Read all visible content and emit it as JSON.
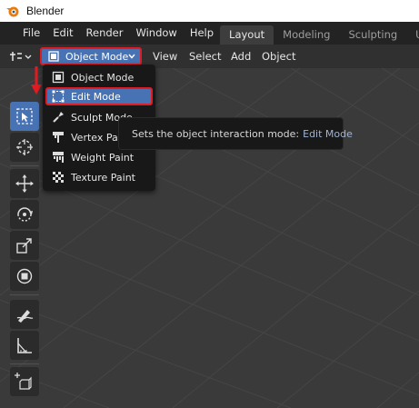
{
  "window": {
    "title": "Blender"
  },
  "menubar": {
    "items": [
      "File",
      "Edit",
      "Render",
      "Window",
      "Help"
    ],
    "workspace_tabs": [
      {
        "label": "Layout",
        "active": true
      },
      {
        "label": "Modeling",
        "active": false
      },
      {
        "label": "Sculpting",
        "active": false
      },
      {
        "label": "UV",
        "active": false
      }
    ]
  },
  "viewport_header": {
    "mode_selected": "Object Mode",
    "menus": [
      "View",
      "Select",
      "Add",
      "Object"
    ]
  },
  "mode_menu": {
    "items": [
      {
        "label": "Object Mode",
        "icon": "object-mode-icon"
      },
      {
        "label": "Edit Mode",
        "icon": "edit-mode-icon",
        "highlighted": true
      },
      {
        "label": "Sculpt Mode",
        "icon": "sculpt-mode-icon"
      },
      {
        "label": "Vertex Paint",
        "icon": "vertex-paint-icon"
      },
      {
        "label": "Weight Paint",
        "icon": "weight-paint-icon"
      },
      {
        "label": "Texture Paint",
        "icon": "texture-paint-icon"
      }
    ]
  },
  "tooltip": {
    "text": "Sets the object interaction mode:",
    "mode": "Edit Mode"
  },
  "toolbar": {
    "tools": [
      "select-box-icon",
      "cursor-icon",
      "move-icon",
      "rotate-icon",
      "scale-icon",
      "transform-icon",
      "annotate-icon",
      "measure-icon",
      "add-cube-icon"
    ]
  },
  "colors": {
    "accent": "#4772b3",
    "annotation_red": "#e01c22",
    "menubar_bg": "#232323",
    "viewport_bg": "#3a3a3a"
  }
}
